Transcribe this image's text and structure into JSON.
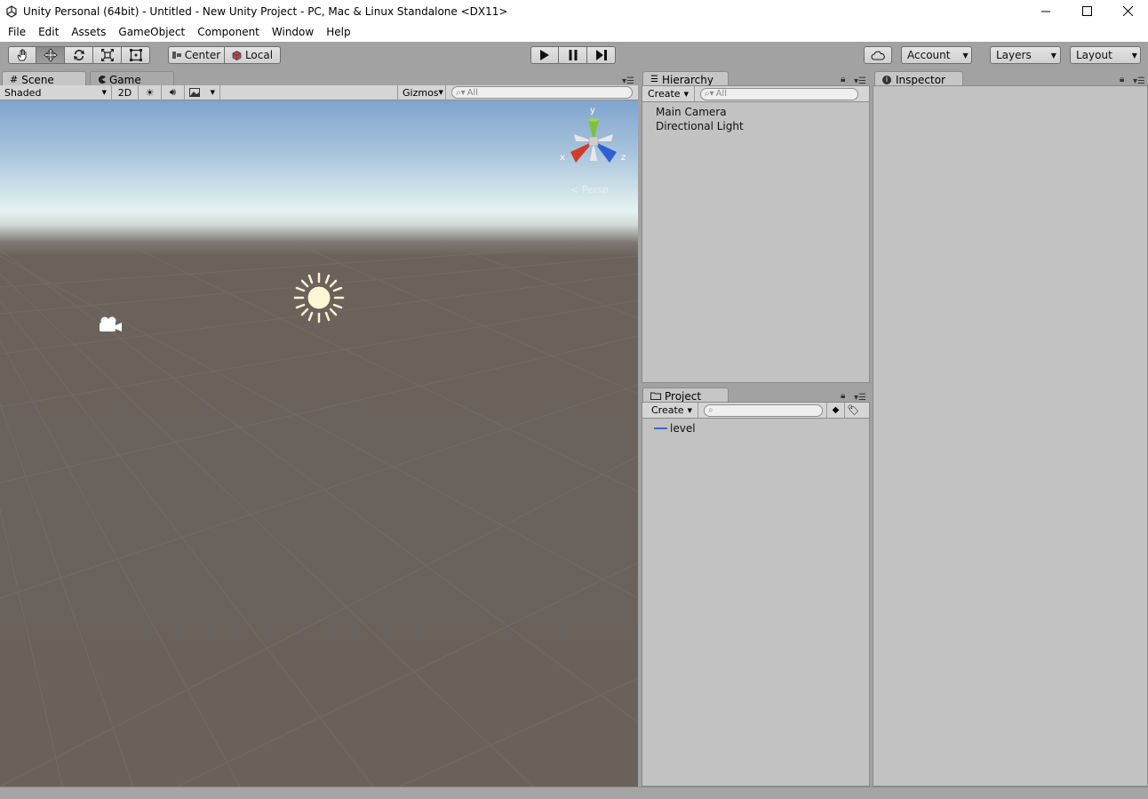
{
  "window": {
    "title": "Unity Personal (64bit) - Untitled - New Unity Project - PC, Mac & Linux Standalone <DX11>",
    "icon": "unity-logo-icon"
  },
  "menu": [
    "File",
    "Edit",
    "Assets",
    "GameObject",
    "Component",
    "Window",
    "Help"
  ],
  "toolbar": {
    "tools": [
      "hand-icon",
      "move-icon",
      "rotate-icon",
      "scale-icon",
      "rect-tool-icon"
    ],
    "active_tool": "move-icon",
    "pivot_mode": "Center",
    "pivot_rotation": "Local",
    "play_controls": [
      "play-icon",
      "pause-icon",
      "step-icon"
    ],
    "account_label": "Account",
    "layers_label": "Layers",
    "layout_label": "Layout"
  },
  "scene_panel": {
    "tabs": [
      "Scene",
      "Game"
    ],
    "shading_mode": "Shaded",
    "mode_2d": "2D",
    "gizmos_label": "Gizmos",
    "search_placeholder": "All",
    "gizmo_axes": {
      "y": "y",
      "x": "x",
      "z": "z"
    },
    "projection_label": "Persp"
  },
  "hierarchy": {
    "tab_label": "Hierarchy",
    "create_label": "Create",
    "search_placeholder": "All",
    "items": [
      "Main Camera",
      "Directional Light"
    ]
  },
  "project": {
    "tab_label": "Project",
    "create_label": "Create",
    "items": [
      "level"
    ]
  },
  "inspector": {
    "tab_label": "Inspector"
  },
  "colors": {
    "chrome": "#a2a2a2",
    "panel": "#c2c2c2",
    "ground": "#6a615b",
    "sky": "#7ea5cf",
    "axis_x": "#d23a2a",
    "axis_y": "#7fc23a",
    "axis_z": "#2f5fd6",
    "level_icon": "#2f6fd0"
  }
}
